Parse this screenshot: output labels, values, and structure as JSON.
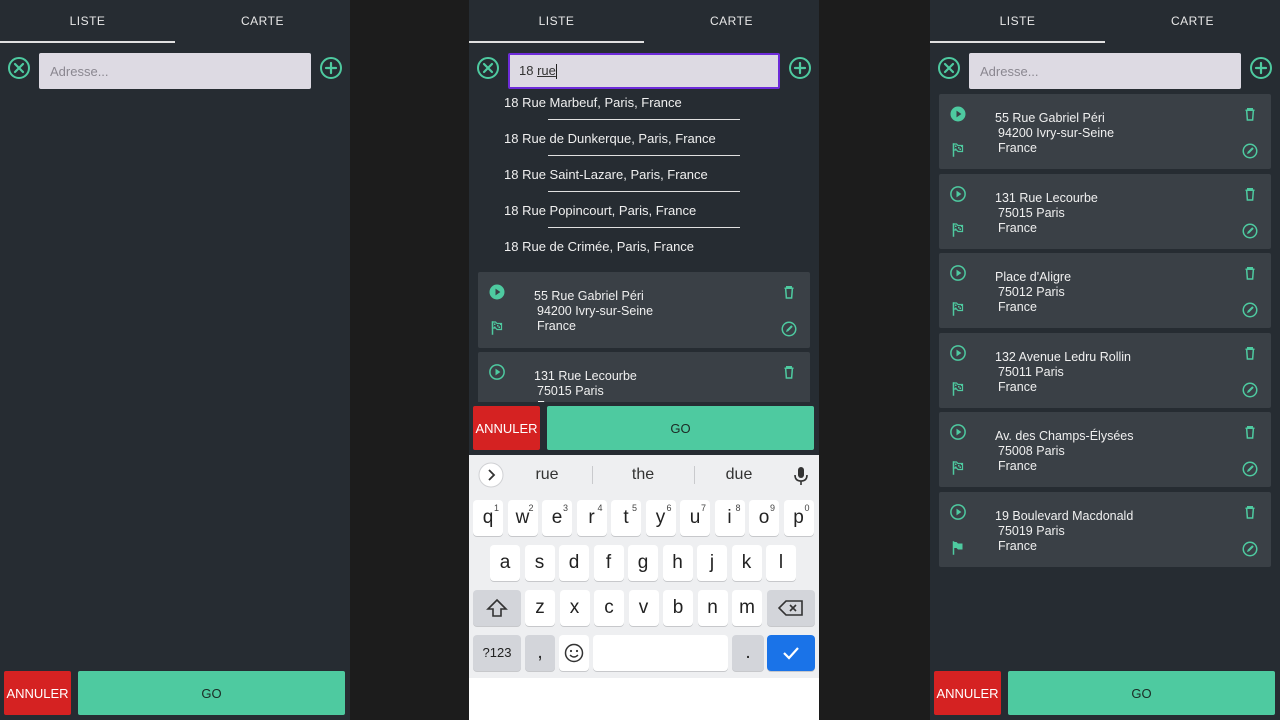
{
  "tabs": {
    "list": "LISTE",
    "map": "CARTE"
  },
  "search": {
    "placeholder": "Adresse...",
    "typed_prefix": "18 ",
    "typed_word": "rue"
  },
  "buttons": {
    "cancel": "ANNULER",
    "go": "GO"
  },
  "suggestions": [
    "18 Rue Marbeuf, Paris, France",
    "18 Rue de Dunkerque, Paris, France",
    "18 Rue Saint-Lazare, Paris, France",
    "18 Rue Popincourt, Paris, France",
    "18 Rue de Crimée, Paris, France"
  ],
  "addresses": [
    {
      "line1": "55 Rue Gabriel Péri",
      "line2": "94200 Ivry-sur-Seine",
      "line3": "France"
    },
    {
      "line1": "131 Rue Lecourbe",
      "line2": "75015 Paris",
      "line3": "France"
    },
    {
      "line1": "Place d'Aligre",
      "line2": "75012 Paris",
      "line3": "France"
    },
    {
      "line1": "132 Avenue Ledru Rollin",
      "line2": "75011 Paris",
      "line3": "France"
    },
    {
      "line1": "Av. des Champs-Élysées",
      "line2": "75008 Paris",
      "line3": "France"
    },
    {
      "line1": "19 Boulevard Macdonald",
      "line2": "75019 Paris",
      "line3": "France"
    }
  ],
  "keyboard": {
    "word_suggestions": [
      "rue",
      "the",
      "due"
    ],
    "row1": [
      {
        "k": "q",
        "n": "1"
      },
      {
        "k": "w",
        "n": "2"
      },
      {
        "k": "e",
        "n": "3"
      },
      {
        "k": "r",
        "n": "4"
      },
      {
        "k": "t",
        "n": "5"
      },
      {
        "k": "y",
        "n": "6"
      },
      {
        "k": "u",
        "n": "7"
      },
      {
        "k": "i",
        "n": "8"
      },
      {
        "k": "o",
        "n": "9"
      },
      {
        "k": "p",
        "n": "0"
      }
    ],
    "row2": [
      "a",
      "s",
      "d",
      "f",
      "g",
      "h",
      "j",
      "k",
      "l"
    ],
    "row3": [
      "z",
      "x",
      "c",
      "v",
      "b",
      "n",
      "m"
    ],
    "symbols": "?123",
    "comma": ",",
    "period": "."
  },
  "colors": {
    "background": "#262c32",
    "card": "#3a4046",
    "accent": "#4ecaa0",
    "cancel": "#d52222",
    "input_focus": "#6d2bd9",
    "keyboard_enter": "#1a73e8"
  }
}
